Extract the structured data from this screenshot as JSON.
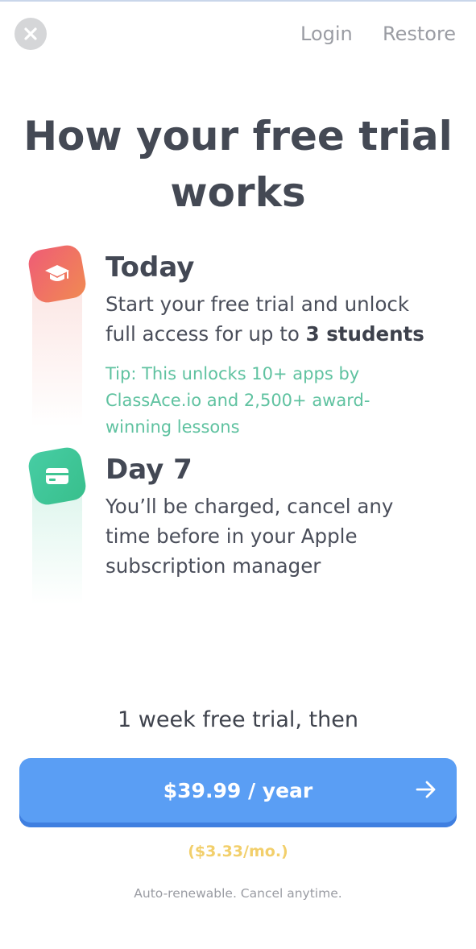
{
  "header": {
    "login_label": "Login",
    "restore_label": "Restore"
  },
  "title": {
    "line1": "How your free trial",
    "line2": "works"
  },
  "steps": [
    {
      "icon": "graduation-cap-icon",
      "heading": "Today",
      "body_prefix": "Start your free trial and unlock full access for up to ",
      "body_bold": "3 students",
      "tip": "Tip: This unlocks 10+ apps by ClassAce.io and 2,500+ award-winning lessons",
      "accent": "#ef5c76"
    },
    {
      "icon": "credit-card-icon",
      "heading": "Day 7",
      "body": "You’ll be charged, cancel any time before in your Apple subscription manager",
      "accent": "#47cda4"
    }
  ],
  "pricing": {
    "trial_note": "1 week free trial, then",
    "button_label": "$39.99 / year",
    "monthly": "($3.33/mo.)",
    "fine_print": "Auto-renewable. Cancel anytime.",
    "button_color": "#5a9ef4",
    "monthly_color": "#f2cf6b",
    "tip_color": "#5fc2a0"
  }
}
